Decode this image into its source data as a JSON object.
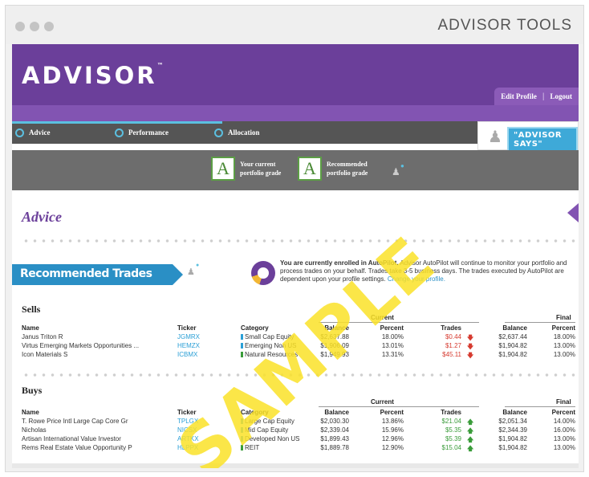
{
  "window": {
    "title": "ADVISOR TOOLS"
  },
  "brand": {
    "logo": "ADVISOR",
    "trademark": "™"
  },
  "profile_nav": {
    "edit_profile": "Edit Profile",
    "separator": "|",
    "logout": "Logout"
  },
  "steps": [
    {
      "label": "Advice"
    },
    {
      "label": "Performance"
    },
    {
      "label": "Allocation"
    }
  ],
  "advisor_says": {
    "label": "\"ADVISOR SAYS\""
  },
  "grades": {
    "current": {
      "grade": "A",
      "caption_1": "Your current",
      "caption_2": "portfolio grade"
    },
    "recommended": {
      "grade": "A",
      "caption_1": "Recommended",
      "caption_2": "portfolio grade"
    }
  },
  "advice": {
    "title": "Advice"
  },
  "recommended_trades": {
    "title": "Recommended Trades",
    "message_bold": "You are currently enrolled in AutoPilot.",
    "message": " Advisor AutoPilot will continue to monitor your portfolio and process trades on your behalf. Trades take 3-5 business days. The trades executed by AutoPilot are dependent upon your profile settings. ",
    "link": "Change your profile."
  },
  "group_headers": {
    "current": "Current",
    "final": "Final"
  },
  "columns": {
    "name": "Name",
    "ticker": "Ticker",
    "category": "Category",
    "balance": "Balance",
    "percent": "Percent",
    "trades": "Trades",
    "final_balance": "Balance",
    "final_percent": "Percent"
  },
  "sells": {
    "title": "Sells",
    "rows": [
      {
        "name": "Janus Triton R",
        "ticker": "JGMRX",
        "category": "Small Cap Equity",
        "cat_color": "#2a9fd6",
        "balance": "$2,637.88",
        "percent": "18.00%",
        "trades": "$0.44",
        "final_balance": "$2,637.44",
        "final_percent": "18.00%"
      },
      {
        "name": "Virtus Emerging Markets Opportunities ...",
        "ticker": "HEMZX",
        "category": "Emerging Non US",
        "cat_color": "#2a9fd6",
        "balance": "$1,906.09",
        "percent": "13.01%",
        "trades": "$1.27",
        "final_balance": "$1,904.82",
        "final_percent": "13.00%"
      },
      {
        "name": "Icon Materials S",
        "ticker": "ICBMX",
        "category": "Natural Resources",
        "cat_color": "#3a9c3a",
        "balance": "$1,949.93",
        "percent": "13.31%",
        "trades": "$45.11",
        "final_balance": "$1,904.82",
        "final_percent": "13.00%"
      }
    ]
  },
  "buys": {
    "title": "Buys",
    "rows": [
      {
        "name": "T. Rowe Price Intl Large Cap Core Gr",
        "ticker": "TPLGX",
        "category": "Large Cap Equity",
        "cat_color": "#2a9fd6",
        "balance": "$2,030.30",
        "percent": "13.86%",
        "trades": "$21.04",
        "final_balance": "$2,051.34",
        "final_percent": "14.00%"
      },
      {
        "name": "Nicholas",
        "ticker": "NICSX",
        "category": "Mid Cap Equity",
        "cat_color": "#2a9fd6",
        "balance": "$2,339.04",
        "percent": "15.96%",
        "trades": "$5.35",
        "final_balance": "$2,344.39",
        "final_percent": "16.00%"
      },
      {
        "name": "Artisan International Value Investor",
        "ticker": "ARTKX",
        "category": "Developed Non US",
        "cat_color": "#2a9fd6",
        "balance": "$1,899.43",
        "percent": "12.96%",
        "trades": "$5.39",
        "final_balance": "$1,904.82",
        "final_percent": "13.00%"
      },
      {
        "name": "Rems Real Estate Value Opportunity P",
        "ticker": "HLPPX",
        "category": "REIT",
        "cat_color": "#3a9c3a",
        "balance": "$1,889.78",
        "percent": "12.90%",
        "trades": "$15.04",
        "final_balance": "$1,904.82",
        "final_percent": "13.00%"
      }
    ]
  },
  "watermark": "SAMPLE",
  "colors": {
    "brand_purple": "#6b3f9a",
    "accent_blue": "#2a8fc5",
    "grade_green": "#5c9e45",
    "sell_red": "#d63a2f",
    "buy_green": "#3a9c3a"
  },
  "icons": {
    "sell_trend": "arrow-down-icon",
    "buy_trend": "arrow-up-icon",
    "advisor": "person-icon",
    "chat": "chat-bubble-icon"
  }
}
